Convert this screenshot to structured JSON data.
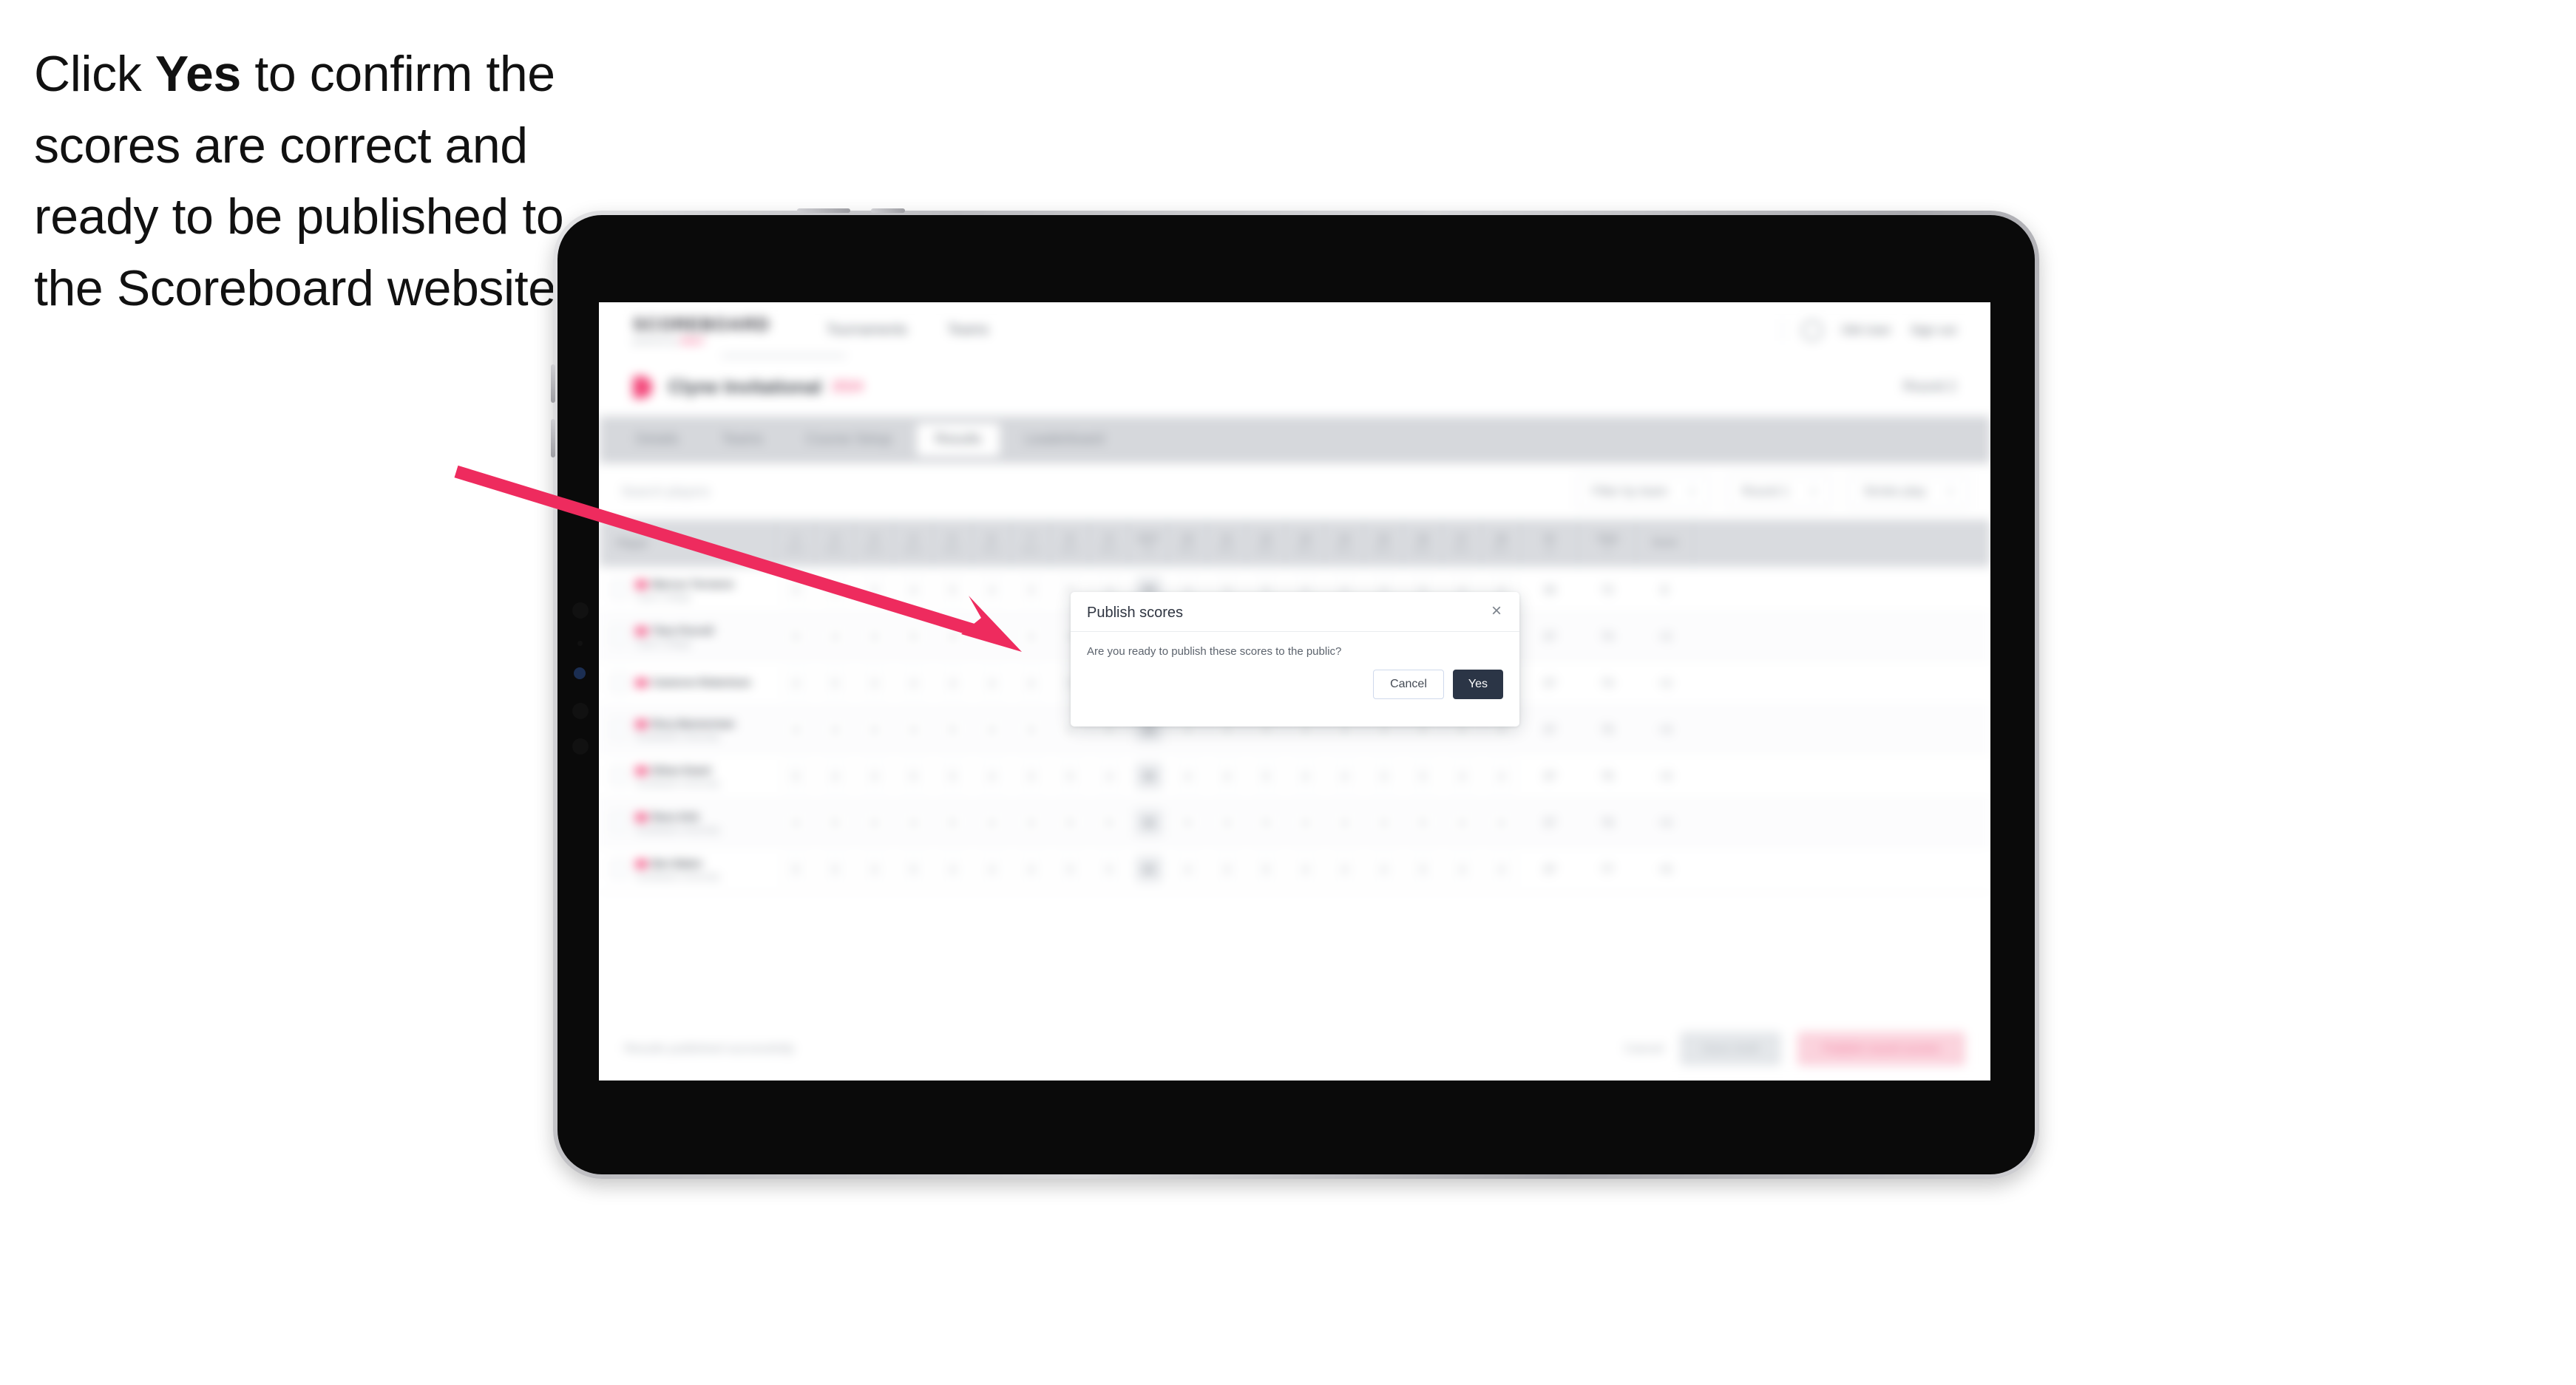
{
  "caption": {
    "before": "Click ",
    "emphasis": "Yes",
    "after": " to confirm the scores are correct and ready to be published to the Scoreboard website."
  },
  "annotation": {
    "arrow_color": "#EE2B5E"
  },
  "app": {
    "brand": {
      "wordmark": "SCOREBOARD",
      "sub_prefix": "powered by ",
      "sub_accent": "GOLF"
    },
    "nav": [
      "Tournaments",
      "Teams"
    ],
    "header_right": [
      "Old User",
      "Sign out"
    ],
    "title": {
      "main": "Clyne Invitational",
      "sub": "2024",
      "right": "Round 2"
    },
    "tabs": [
      {
        "label": "Details",
        "active": false
      },
      {
        "label": "Teams",
        "active": false
      },
      {
        "label": "Course Setup",
        "active": false
      },
      {
        "label": "Results",
        "active": true
      },
      {
        "label": "Leaderboard",
        "active": false
      }
    ],
    "filters": {
      "search_placeholder": "Search players",
      "pills": [
        {
          "label": "Filter by team",
          "caret": "▾"
        },
        {
          "label": "Round 1",
          "caret": "▾"
        },
        {
          "label": "Stroke play",
          "caret": "▾"
        }
      ]
    },
    "table": {
      "player_column": "Player",
      "holes": [
        {
          "num": "1",
          "par": "Par 4"
        },
        {
          "num": "2",
          "par": "Par 4"
        },
        {
          "num": "3",
          "par": "Par 3"
        },
        {
          "num": "4",
          "par": "Par 5"
        },
        {
          "num": "5",
          "par": "Par 4"
        },
        {
          "num": "6",
          "par": "Par 4"
        },
        {
          "num": "7",
          "par": "Par 3"
        },
        {
          "num": "8",
          "par": "Par 5"
        },
        {
          "num": "9",
          "par": "Par 4"
        },
        {
          "num": "OUT",
          "par": "36"
        },
        {
          "num": "10",
          "par": "Par 4"
        },
        {
          "num": "11",
          "par": "Par 3"
        },
        {
          "num": "12",
          "par": "Par 5"
        },
        {
          "num": "13",
          "par": "Par 4"
        },
        {
          "num": "14",
          "par": "Par 4"
        },
        {
          "num": "15",
          "par": "Par 3"
        },
        {
          "num": "16",
          "par": "Par 5"
        },
        {
          "num": "17",
          "par": "Par 4"
        },
        {
          "num": "18",
          "par": "Par 4"
        }
      ],
      "tail_columns": [
        {
          "num": "IN",
          "par": "36"
        },
        {
          "num": "Total",
          "par": "72"
        },
        {
          "num": "Score",
          "par": ""
        }
      ],
      "rows": [
        {
          "name": "Marcus Torrance",
          "club": "Clyne College",
          "scores": [
            "4",
            "4",
            "3",
            "4",
            "5",
            "4",
            "3",
            "5",
            "4",
            "36",
            "4",
            "3",
            "5",
            "4",
            "4",
            "3",
            "5",
            "4",
            "4"
          ],
          "in": "36",
          "total": "72",
          "score": "E"
        },
        {
          "name": "Theo Purcell",
          "club": "Clyne College",
          "scores": [
            "5",
            "4",
            "3",
            "5",
            "4",
            "4",
            "3",
            "5",
            "4",
            "37",
            "4",
            "3",
            "5",
            "4",
            "5",
            "3",
            "5",
            "4",
            "4"
          ],
          "in": "37",
          "total": "74",
          "score": "+2"
        },
        {
          "name": "Cameron Robertson",
          "club": "",
          "scores": [
            "4",
            "5",
            "3",
            "4",
            "4",
            "4",
            "4",
            "5",
            "4",
            "37",
            "4",
            "3",
            "5",
            "5",
            "4",
            "3",
            "5",
            "4",
            "4"
          ],
          "in": "37",
          "total": "74",
          "score": "+2"
        },
        {
          "name": "Rory Bannerman",
          "club": "Southbank University",
          "scores": [
            "4",
            "4",
            "4",
            "4",
            "5",
            "4",
            "3",
            "5",
            "5",
            "38",
            "4",
            "3",
            "5",
            "4",
            "4",
            "3",
            "5",
            "5",
            "4"
          ],
          "in": "37",
          "total": "75",
          "score": "+3"
        },
        {
          "name": "Ethan Ewart",
          "club": "Southbank University",
          "scores": [
            "5",
            "4",
            "3",
            "5",
            "5",
            "4",
            "3",
            "5",
            "4",
            "38",
            "4",
            "4",
            "5",
            "4",
            "4",
            "3",
            "5",
            "4",
            "4"
          ],
          "in": "37",
          "total": "75",
          "score": "+3"
        },
        {
          "name": "Rees Kirk",
          "club": "Southbank University",
          "scores": [
            "4",
            "5",
            "4",
            "4",
            "5",
            "4",
            "3",
            "5",
            "5",
            "39",
            "5",
            "3",
            "5",
            "4",
            "4",
            "3",
            "5",
            "4",
            "4"
          ],
          "in": "37",
          "total": "76",
          "score": "+4"
        },
        {
          "name": "Ben Baker",
          "club": "Southbank University",
          "scores": [
            "5",
            "5",
            "3",
            "5",
            "4",
            "4",
            "4",
            "5",
            "5",
            "40",
            "4",
            "3",
            "5",
            "4",
            "4",
            "4",
            "5",
            "4",
            "4"
          ],
          "in": "37",
          "total": "77",
          "score": "+5"
        }
      ]
    },
    "footer": {
      "note": "Results published successfully",
      "link_label": "Cancel",
      "gray_button": "Save draft",
      "pink_button": "Publish round scores"
    }
  },
  "modal": {
    "title": "Publish scores",
    "close_icon": "×",
    "message": "Are you ready to publish these scores to the public?",
    "cancel_label": "Cancel",
    "confirm_label": "Yes"
  }
}
